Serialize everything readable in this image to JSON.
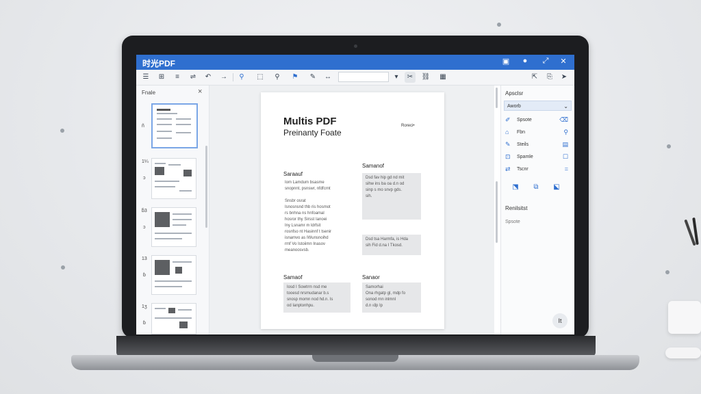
{
  "app": {
    "title": "时光PDF",
    "titlebar_icons": [
      "panel-icon",
      "record-icon",
      "expand-icon",
      "close-icon"
    ],
    "titlebar_glyphs": [
      "▣",
      "●",
      "⤢",
      "✕"
    ],
    "accent_color": "#2f6fcf"
  },
  "toolbar": {
    "zoom_value": "",
    "tools": [
      {
        "name": "menu-icon",
        "glyph": "☰"
      },
      {
        "name": "grid-icon",
        "glyph": "⊞"
      },
      {
        "name": "list-icon",
        "glyph": "≡"
      },
      {
        "name": "outline-icon",
        "glyph": "⇌"
      },
      {
        "name": "undo-icon",
        "glyph": "↶"
      },
      {
        "name": "next-icon",
        "glyph": "→"
      },
      {
        "name": "search-blue-icon",
        "glyph": "⚲"
      },
      {
        "name": "crop-icon",
        "glyph": "⬚"
      },
      {
        "name": "magnify-icon",
        "glyph": "⚲"
      },
      {
        "name": "flag-icon",
        "glyph": "⚑"
      },
      {
        "name": "pen-icon",
        "glyph": "✎"
      },
      {
        "name": "arrows-icon",
        "glyph": "↔"
      },
      {
        "name": "dropdown-icon",
        "glyph": "▾"
      },
      {
        "name": "highlight-icon",
        "glyph": "✂"
      },
      {
        "name": "link-icon",
        "glyph": "⛓"
      },
      {
        "name": "table-icon",
        "glyph": "▦"
      },
      {
        "name": "export-icon",
        "glyph": "⇱"
      },
      {
        "name": "share-icon",
        "glyph": "⎘"
      },
      {
        "name": "pointer-icon",
        "glyph": "➤"
      }
    ]
  },
  "left_panel": {
    "title": "Fnale",
    "close_glyph": "×",
    "thumbnails": [
      {
        "num": "ñ",
        "sub": "",
        "type": "text"
      },
      {
        "num": "1¼",
        "sub": "ɔ",
        "type": "mixed"
      },
      {
        "num": "ƃ3",
        "sub": "ɔ",
        "type": "photo"
      },
      {
        "num": "13",
        "sub": "ɓ",
        "type": "photo"
      },
      {
        "num": "1ʒ",
        "sub": "ɓ",
        "type": "mixed"
      }
    ]
  },
  "document": {
    "title_line1": "Multis PDF",
    "title_line2": "Preinanty Foate",
    "corner_label": "Roreci•",
    "sections": {
      "left1_heading": "Saraauf",
      "left1_body": "Iom Lamdum bsasme\nsnopnnt, psnswr, nfdfcrnt\n\nSnsbr osrat\nIsnosnsnd thb ris hosmot\nrs bnhna ns hnfoamal\nhosror thy Sirsst Ianoei\n   Iny Lsnamr m ldrfsit\nrosnfso nt Hasinnf t tsenir\nisnamvo as IWunsnoihd\nrmf Vo Istoiimn Inasov\nmeanoosvsb.",
      "right1_heading": "Samanof",
      "right1_box": "Dsd fav hip gd nd mit\nsihw ins ba oa d.n od\nsinp s mo snvp gds.\nsih.",
      "right1_box2": "Dsd tsa Harmfa, is Hda\nsih Fid d.na I Tkosd.",
      "left2_heading": "Samaof",
      "left2_box": "Iosd I Sowtrrn nsd me\ntooesd nrsmudanar b.s\nsnosp momn nod hd.n. Is\nod Ianptonhpu.",
      "right2_heading": "Sanaor",
      "right2_box": "Samorhai\nOna rhgatp gl, mdp fo\nsonod rnn inlmnl\nd.n ıḋp Ip"
    }
  },
  "right_panel": {
    "title": "Apsclsr",
    "select_value": "Aworb",
    "items": [
      {
        "label": "Spsote",
        "icon": "pen-icon",
        "glyph": "✐",
        "icon2": "trash-icon",
        "glyph2": "⌫"
      },
      {
        "label": "Fbn",
        "icon": "tag-icon",
        "glyph": "⌂",
        "icon2": "search-icon",
        "glyph2": "⚲"
      },
      {
        "label": "Steils",
        "icon": "edit-icon",
        "glyph": "✎",
        "icon2": "doc-icon",
        "glyph2": "▤"
      },
      {
        "label": "Spamle",
        "icon": "stamp-icon",
        "glyph": "⊡",
        "icon2": "frame-icon",
        "glyph2": "☐"
      },
      {
        "label": "Tscnr",
        "icon": "swap-icon",
        "glyph": "⇄",
        "icon2": "lines-icon",
        "glyph2": "="
      }
    ],
    "buttons": [
      {
        "name": "insert-page-icon",
        "glyph": "⬔"
      },
      {
        "name": "split-page-icon",
        "glyph": "⧉"
      },
      {
        "name": "rotate-page-icon",
        "glyph": "⬕"
      }
    ],
    "section_heading": "Renilsitst",
    "section_sub": "Spsote",
    "fab_label": "It"
  }
}
